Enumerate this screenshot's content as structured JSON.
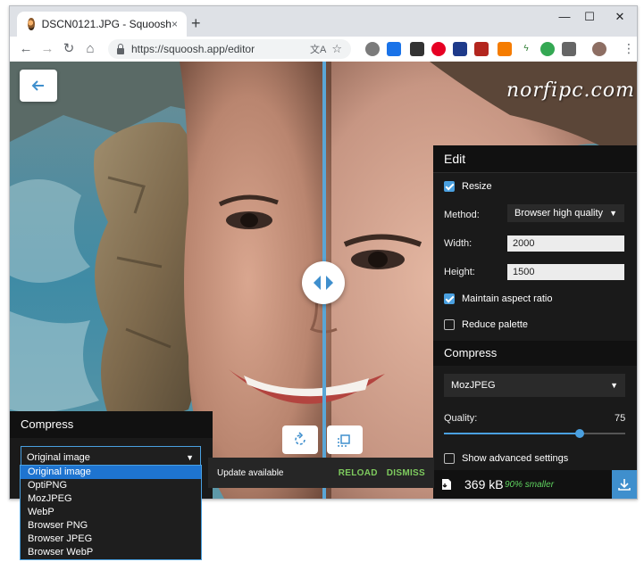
{
  "browser": {
    "tab_title": "DSCN0121.JPG - Squoosh",
    "tab_close": "×",
    "new_tab": "+",
    "url": "https://squoosh.app/editor",
    "minimize": "—",
    "maximize": "☐",
    "close": "✕",
    "back": "←",
    "forward": "→",
    "reload": "↻",
    "home": "⌂",
    "translate": "文A",
    "bookmark": "☆",
    "menu": "⋮"
  },
  "watermark": "norfipc.com",
  "edit_panel": {
    "title": "Edit",
    "resize_label": "Resize",
    "resize_checked": true,
    "method_label": "Method:",
    "method_value": "Browser high quality",
    "width_label": "Width:",
    "width_value": "2000",
    "height_label": "Height:",
    "height_value": "1500",
    "maintain_aspect_label": "Maintain aspect ratio",
    "maintain_aspect_checked": true,
    "reduce_palette_label": "Reduce palette",
    "reduce_palette_checked": false,
    "compress_title": "Compress",
    "codec_value": "MozJPEG",
    "quality_label": "Quality:",
    "quality_value": "75",
    "quality_max": 100,
    "show_advanced_label": "Show advanced settings",
    "show_advanced_checked": false,
    "file_size": "369 kB",
    "savings": "90% smaller"
  },
  "left_panel": {
    "title": "Compress",
    "select_value": "Original image",
    "options": [
      "Original image",
      "OptiPNG",
      "MozJPEG",
      "WebP",
      "Browser PNG",
      "Browser JPEG",
      "Browser WebP"
    ],
    "selected_index": 0
  },
  "toast": {
    "message": "Update available",
    "reload": "RELOAD",
    "dismiss": "DISMISS"
  },
  "colors": {
    "accent": "#4aa0e0",
    "panel": "#1a1a1a",
    "toast_action": "#7ecb5e",
    "savings": "#5fd35f"
  }
}
